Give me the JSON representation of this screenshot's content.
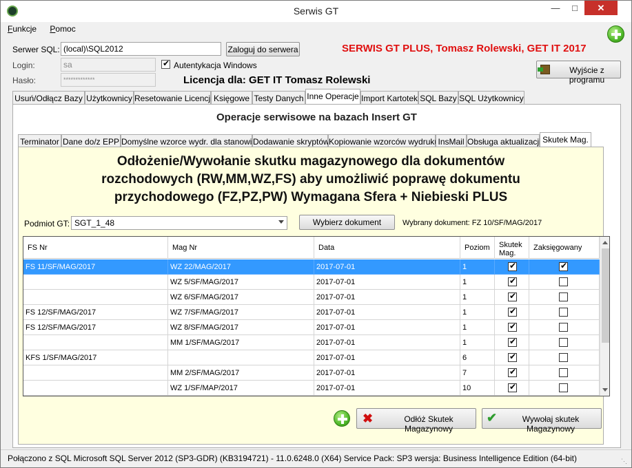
{
  "window": {
    "title": "Serwis GT"
  },
  "menu": {
    "items": [
      "Funkcje",
      "Pomoc"
    ]
  },
  "connection": {
    "server_label": "Serwer SQL:",
    "server_value": "(local)\\SQL2012",
    "login_button": "Zaloguj do serwera",
    "login_label": "Login:",
    "login_value": "sa",
    "password_label": "Hasło:",
    "password_value": "*************",
    "windows_auth_label": "Autentykacja Windows",
    "windows_auth_checked": true
  },
  "brand_text": "SERWIS GT PLUS, Tomasz Rolewski, GET IT 2017",
  "license_text": "Licencja dla: GET IT Tomasz Rolewski",
  "exit_button": "Wyjście z programu",
  "main_tabs": [
    "Usuń/Odłącz Bazy",
    "Użytkownicy",
    "Resetowanie Licencji",
    "Księgowe",
    "Testy Danych",
    "Inne Operacje",
    "Import Kartotek",
    "SQL Bazy",
    "SQL Użytkownicy"
  ],
  "main_tab_active": "Inne Operacje",
  "panel_title": "Operacje serwisowe na bazach Insert GT",
  "sub_tabs": [
    "Terminator",
    "Dane do/z EPP",
    "Domyślne wzorce wydr. dla stanowisk",
    "Dodawanie skryptów",
    "Kopiowanie wzorców wydruku",
    "InsMail",
    "Obsługa aktualizacji",
    "Skutek Mag."
  ],
  "sub_tab_active": "Skutek Mag.",
  "heading_lines": [
    "Odłożenie/Wywołanie skutku magazynowego dla dokumentów",
    "rozchodowych (RW,MM,WZ,FS) aby umożliwić poprawę dokumentu",
    "przychodowego (FZ,PZ,PW) Wymagana Sfera + Niebieski PLUS"
  ],
  "subject": {
    "label": "Podmiot GT:",
    "value": "SGT_1_48",
    "choose_button": "Wybierz dokument",
    "selected_label": "Wybrany dokument: FZ 10/SF/MAG/2017"
  },
  "grid": {
    "columns": [
      "FS Nr",
      "Mag Nr",
      "Data",
      "Poziom",
      "Skutek Mag.",
      "Zaksięgowany"
    ],
    "rows": [
      {
        "fs": "FS 11/SF/MAG/2017",
        "mag": "WZ 22/MAG/2017",
        "date": "2017-07-01",
        "level": "1",
        "skutek": true,
        "zaks": true,
        "selected": true
      },
      {
        "fs": "",
        "mag": "WZ 5/SF/MAG/2017",
        "date": "2017-07-01",
        "level": "1",
        "skutek": true,
        "zaks": false,
        "selected": false
      },
      {
        "fs": "",
        "mag": "WZ 6/SF/MAG/2017",
        "date": "2017-07-01",
        "level": "1",
        "skutek": true,
        "zaks": false,
        "selected": false
      },
      {
        "fs": "FS 12/SF/MAG/2017",
        "mag": "WZ 7/SF/MAG/2017",
        "date": "2017-07-01",
        "level": "1",
        "skutek": true,
        "zaks": false,
        "selected": false
      },
      {
        "fs": "FS 12/SF/MAG/2017",
        "mag": "WZ 8/SF/MAG/2017",
        "date": "2017-07-01",
        "level": "1",
        "skutek": true,
        "zaks": false,
        "selected": false
      },
      {
        "fs": "",
        "mag": "MM 1/SF/MAG/2017",
        "date": "2017-07-01",
        "level": "1",
        "skutek": true,
        "zaks": false,
        "selected": false
      },
      {
        "fs": "KFS 1/SF/MAG/2017",
        "mag": "",
        "date": "2017-07-01",
        "level": "6",
        "skutek": true,
        "zaks": false,
        "selected": false
      },
      {
        "fs": "",
        "mag": "MM 2/SF/MAG/2017",
        "date": "2017-07-01",
        "level": "7",
        "skutek": true,
        "zaks": false,
        "selected": false
      },
      {
        "fs": "",
        "mag": "WZ 1/SF/MAP/2017",
        "date": "2017-07-01",
        "level": "10",
        "skutek": true,
        "zaks": false,
        "selected": false
      }
    ]
  },
  "actions": {
    "defer_button": "Odłóż Skutek Magazynowy",
    "invoke_button": "Wywołaj skutek Magazynowy"
  },
  "status": {
    "text": "Połączono z SQL  Microsoft SQL Server 2012 (SP3-GDR) (KB3194721) - 11.0.6248.0 (X64)  Service Pack: SP3  wersja: Business Intelligence Edition (64-bit)"
  }
}
